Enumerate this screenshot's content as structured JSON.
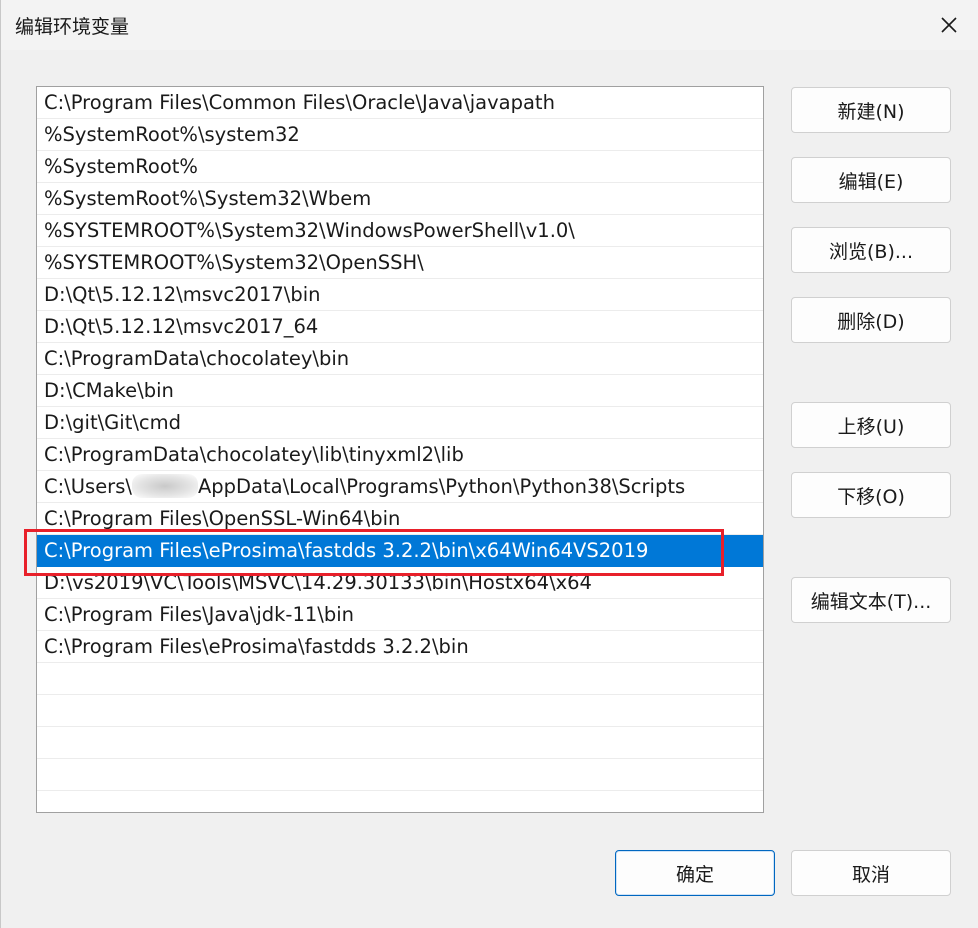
{
  "window": {
    "title": "编辑环境变量"
  },
  "paths": [
    {
      "text": "C:\\Program Files\\Common Files\\Oracle\\Java\\javapath"
    },
    {
      "text": "%SystemRoot%\\system32"
    },
    {
      "text": "%SystemRoot%"
    },
    {
      "text": "%SystemRoot%\\System32\\Wbem"
    },
    {
      "text": "%SYSTEMROOT%\\System32\\WindowsPowerShell\\v1.0\\"
    },
    {
      "text": "%SYSTEMROOT%\\System32\\OpenSSH\\"
    },
    {
      "text": "D:\\Qt\\5.12.12\\msvc2017\\bin"
    },
    {
      "text": "D:\\Qt\\5.12.12\\msvc2017_64"
    },
    {
      "text": "C:\\ProgramData\\chocolatey\\bin"
    },
    {
      "text": "D:\\CMake\\bin"
    },
    {
      "text": "D:\\git\\Git\\cmd"
    },
    {
      "text": "C:\\ProgramData\\chocolatey\\lib\\tinyxml2\\lib"
    },
    {
      "text_before": "C:\\Users\\",
      "text_after": "AppData\\Local\\Programs\\Python\\Python38\\Scripts",
      "redacted": true
    },
    {
      "text": "C:\\Program Files\\OpenSSL-Win64\\bin"
    },
    {
      "text": "C:\\Program Files\\eProsima\\fastdds 3.2.2\\bin\\x64Win64VS2019",
      "selected": true
    },
    {
      "text": "D:\\vs2019\\VC\\Tools\\MSVC\\14.29.30133\\bin\\Hostx64\\x64"
    },
    {
      "text": "C:\\Program Files\\Java\\jdk-11\\bin"
    },
    {
      "text": "C:\\Program Files\\eProsima\\fastdds 3.2.2\\bin"
    }
  ],
  "buttons": {
    "new": "新建(N)",
    "edit": "编辑(E)",
    "browse": "浏览(B)...",
    "delete": "删除(D)",
    "move_up": "上移(U)",
    "move_down": "下移(O)",
    "edit_text": "编辑文本(T)...",
    "ok": "确定",
    "cancel": "取消"
  },
  "colors": {
    "selection": "#0078d7",
    "annotation": "#e8202a",
    "primary_border": "#0067c0"
  },
  "icons": {
    "close": "close-icon"
  }
}
